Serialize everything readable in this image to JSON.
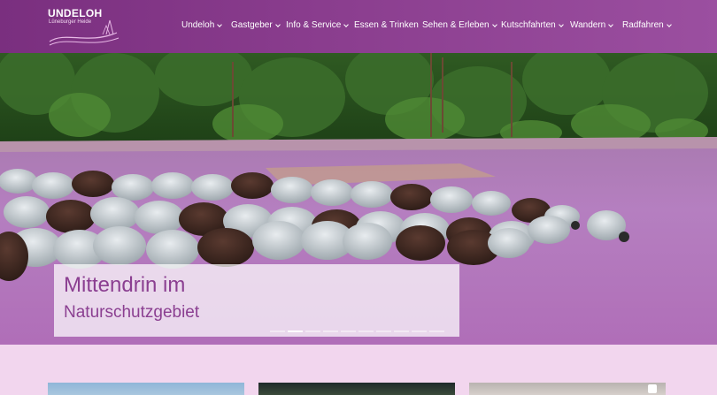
{
  "brand": {
    "title": "UNDELOH",
    "subtitle": "Lüneburger Heide"
  },
  "nav": {
    "items": [
      {
        "label": "Undeloh",
        "dropdown": true
      },
      {
        "label": "Gastgeber",
        "dropdown": true
      },
      {
        "label": "Info & Service",
        "dropdown": true
      },
      {
        "label": "Essen & Trinken",
        "dropdown": false
      },
      {
        "label": "Sehen & Erleben",
        "dropdown": true
      },
      {
        "label": "Kutschfahrten",
        "dropdown": true
      },
      {
        "label": "Wandern",
        "dropdown": true
      },
      {
        "label": "Radfahren",
        "dropdown": true
      }
    ]
  },
  "hero": {
    "caption_line1": "Mittendrin im",
    "caption_line2": "Naturschutzgebiet",
    "slide_count": 10,
    "active_slide": 2
  },
  "colors": {
    "header": "#8a3d8e",
    "accent_text": "#8b3f91",
    "page_bg": "#f2d6ee"
  }
}
